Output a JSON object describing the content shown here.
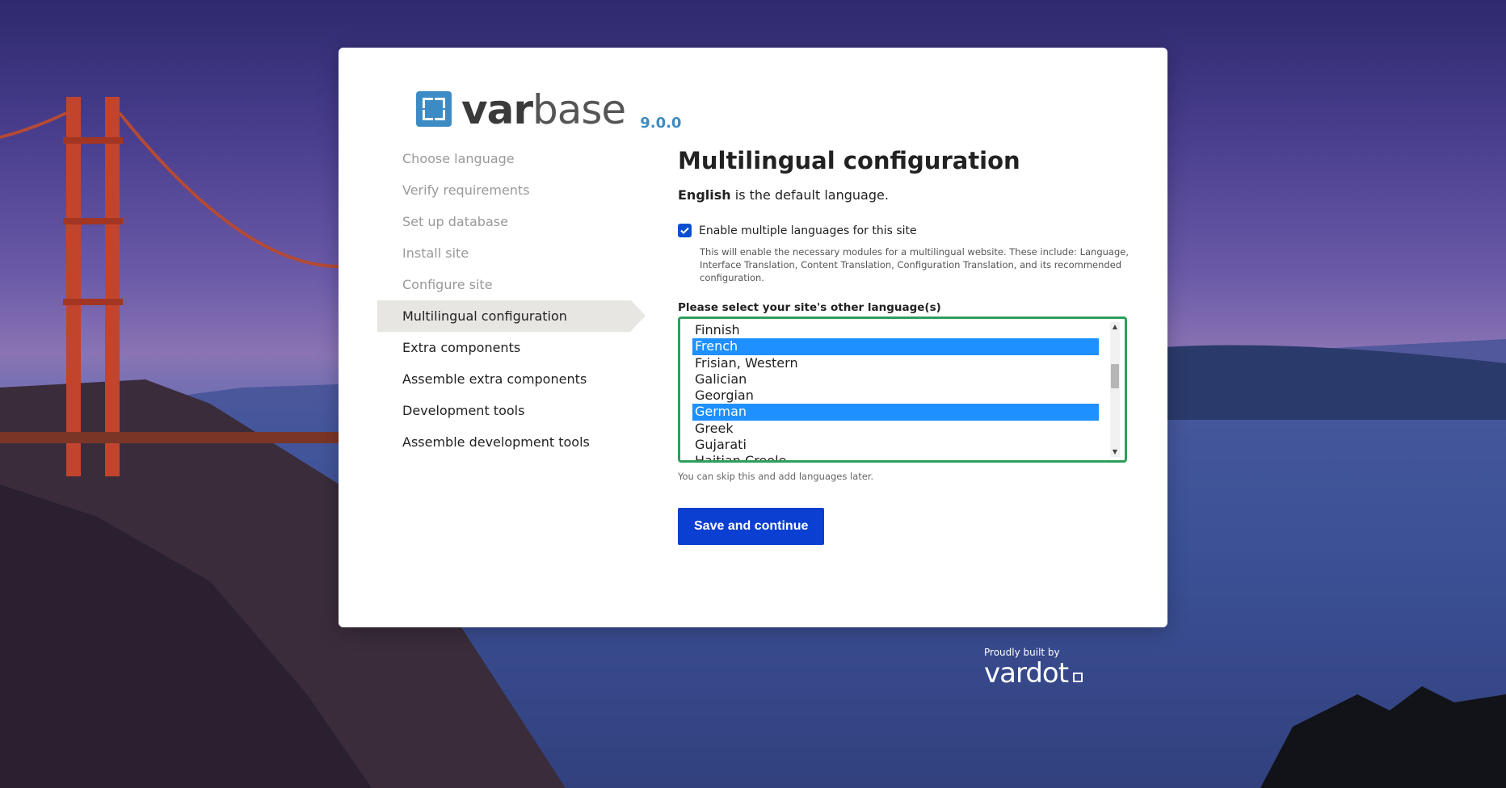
{
  "brand": {
    "name_bold": "var",
    "name_light": "base",
    "version": "9.0.0"
  },
  "steps": [
    {
      "label": "Choose language",
      "state": "done"
    },
    {
      "label": "Verify requirements",
      "state": "done"
    },
    {
      "label": "Set up database",
      "state": "done"
    },
    {
      "label": "Install site",
      "state": "done"
    },
    {
      "label": "Configure site",
      "state": "done"
    },
    {
      "label": "Multilingual configuration",
      "state": "active"
    },
    {
      "label": "Extra components",
      "state": "todo"
    },
    {
      "label": "Assemble extra components",
      "state": "todo"
    },
    {
      "label": "Development tools",
      "state": "todo"
    },
    {
      "label": "Assemble development tools",
      "state": "todo"
    }
  ],
  "main": {
    "title": "Multilingual configuration",
    "default_language": "English",
    "default_language_suffix": " is the default language.",
    "enable_label": "Enable multiple languages for this site",
    "enable_checked": true,
    "enable_help": "This will enable the necessary modules for a multilingual website. These include: Language, Interface Translation, Content Translation, Configuration Translation, and its recommended configuration.",
    "select_label": "Please select your site's other language(s)",
    "languages": [
      {
        "label": "Finnish",
        "selected": false
      },
      {
        "label": "French",
        "selected": true
      },
      {
        "label": "Frisian, Western",
        "selected": false
      },
      {
        "label": "Galician",
        "selected": false
      },
      {
        "label": "Georgian",
        "selected": false
      },
      {
        "label": "German",
        "selected": true
      },
      {
        "label": "Greek",
        "selected": false
      },
      {
        "label": "Gujarati",
        "selected": false
      },
      {
        "label": "Haitian Creole",
        "selected": false
      }
    ],
    "skip_note": "You can skip this and add languages later.",
    "submit_label": "Save and continue"
  },
  "footer": {
    "built_by": "Proudly built by",
    "company": "vardot"
  },
  "colors": {
    "accent": "#3d8bc4",
    "button": "#0b3fd1",
    "selected_option": "#1e90ff",
    "focus_border": "#2e9e5b"
  }
}
